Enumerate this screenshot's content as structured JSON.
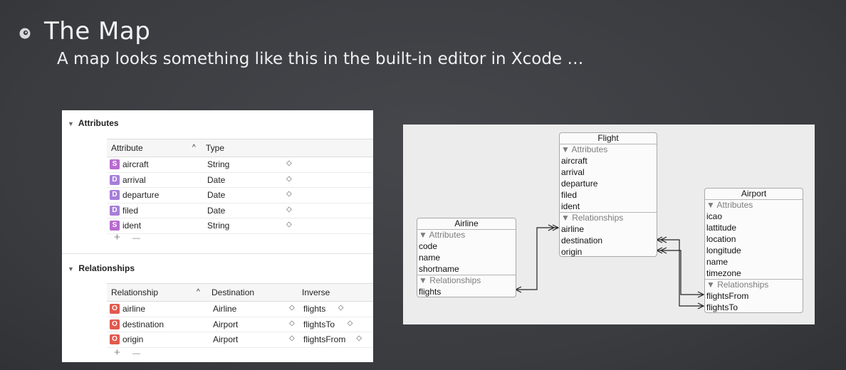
{
  "slide": {
    "title": "The Map",
    "subtitle": "A map looks something like this in the built-in editor in Xcode …"
  },
  "editor": {
    "attributes_section": "Attributes",
    "attr_headers": {
      "attribute": "Attribute",
      "sort": "^",
      "type": "Type"
    },
    "attributes": [
      {
        "badge": "S",
        "name": "aircraft",
        "type": "String"
      },
      {
        "badge": "D",
        "name": "arrival",
        "type": "Date"
      },
      {
        "badge": "D",
        "name": "departure",
        "type": "Date"
      },
      {
        "badge": "D",
        "name": "filed",
        "type": "Date"
      },
      {
        "badge": "S",
        "name": "ident",
        "type": "String"
      }
    ],
    "relationships_section": "Relationships",
    "rel_headers": {
      "relationship": "Relationship",
      "sort": "^",
      "destination": "Destination",
      "inverse": "Inverse"
    },
    "relationships": [
      {
        "badge": "O",
        "name": "airline",
        "destination": "Airline",
        "inverse": "flights"
      },
      {
        "badge": "O",
        "name": "destination",
        "destination": "Airport",
        "inverse": "flightsTo"
      },
      {
        "badge": "O",
        "name": "origin",
        "destination": "Airport",
        "inverse": "flightsFrom"
      }
    ],
    "add": "+",
    "remove": "—",
    "stepper": "◇"
  },
  "diagram": {
    "flight": {
      "name": "Flight",
      "attributes_label": "▼ Attributes",
      "attributes": [
        "aircraft",
        "arrival",
        "departure",
        "filed",
        "ident"
      ],
      "relationships_label": "▼ Relationships",
      "relationships": [
        "airline",
        "destination",
        "origin"
      ]
    },
    "airline": {
      "name": "Airline",
      "attributes_label": "▼ Attributes",
      "attributes": [
        "code",
        "name",
        "shortname"
      ],
      "relationships_label": "▼ Relationships",
      "relationships": [
        "flights"
      ]
    },
    "airport": {
      "name": "Airport",
      "attributes_label": "▼ Attributes",
      "attributes": [
        "icao",
        "lattitude",
        "location",
        "longitude",
        "name",
        "timezone"
      ],
      "relationships_label": "▼ Relationships",
      "relationships": [
        "flightsFrom",
        "flightsTo"
      ]
    }
  },
  "colors": {
    "badge_string": "#b86bd0",
    "badge_date": "#a77fd8",
    "badge_relationship": "#e05a4e",
    "slide_background": "#3b3d41"
  }
}
